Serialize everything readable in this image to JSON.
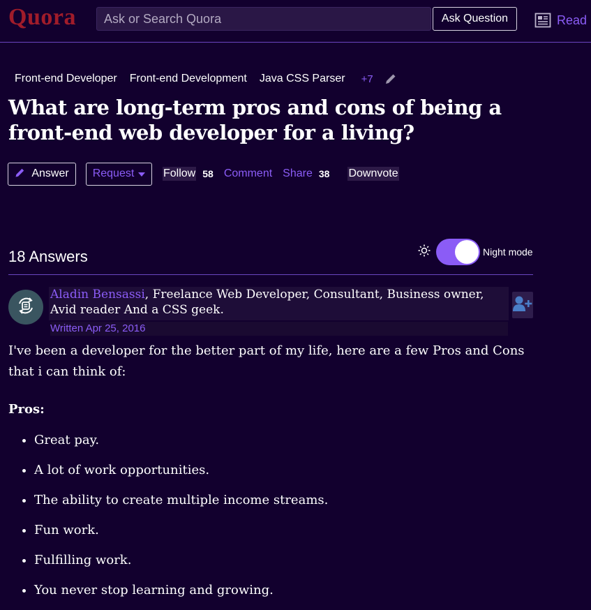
{
  "header": {
    "logo": "Quora",
    "search_placeholder": "Ask or Search Quora",
    "ask_button": "Ask Question",
    "read_label": "Read"
  },
  "topics": {
    "items": [
      "Front-end Developer",
      "Front-end Development",
      "Java CSS Parser"
    ],
    "more": "+7"
  },
  "question": {
    "title": "What are long-term pros and cons of being a front-end web developer for a living?"
  },
  "actions": {
    "answer": "Answer",
    "request": "Request",
    "follow": "Follow",
    "follow_count": "58",
    "comment": "Comment",
    "share": "Share",
    "share_count": "38",
    "downvote": "Downvote"
  },
  "answers": {
    "count_label": "18 Answers",
    "night_mode_label": "Night mode",
    "night_mode_on": true
  },
  "answer": {
    "author_name": "Aladin Bensassi",
    "author_credential": ", Freelance Web Developer, Consultant, Business owner, Avid reader And a CSS geek.",
    "written": "Written Apr 25, 2016",
    "intro": "I've been a developer for the better part of my life, here are a few Pros and Cons that i can think of:",
    "pros_heading": "Pros:",
    "pros": [
      "Great pay.",
      "A lot of work opportunities.",
      "The ability to create multiple income streams.",
      "Fun work.",
      "Fulfilling work.",
      "You never stop learning and growing."
    ]
  },
  "colors": {
    "background": "#12002e",
    "accent": "#8b5cf6",
    "logo": "#a01c2a",
    "divider": "#6b46c1"
  },
  "icons": {
    "read": "newspaper-icon",
    "edit": "pencil-icon",
    "answer": "pencil-icon",
    "request": "caret-down-icon",
    "night": "sun-icon",
    "follow_user": "add-user-icon",
    "avatar": "avatar-icon"
  }
}
